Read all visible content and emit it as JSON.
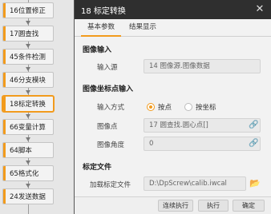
{
  "flow": {
    "nodes": [
      {
        "label": "16位置修正"
      },
      {
        "label": "17圆查找"
      },
      {
        "label": "45条件检测"
      },
      {
        "label": "46分支模块"
      },
      {
        "label": "18标定转换"
      },
      {
        "label": "66变量计算"
      },
      {
        "label": "64脚本"
      },
      {
        "label": "65格式化"
      },
      {
        "label": "24发送数据"
      }
    ]
  },
  "dialog": {
    "title": "18 标定转换",
    "tabs": [
      {
        "label": "基本参数"
      },
      {
        "label": "结果显示"
      }
    ],
    "image_input": {
      "section": "图像输入",
      "source_label": "输入源",
      "source_value": "14 图像源.图像数据"
    },
    "coord_input": {
      "section": "图像坐标点输入",
      "mode_label": "输入方式",
      "mode_options": [
        {
          "label": "按点"
        },
        {
          "label": "按坐标"
        }
      ],
      "point_label": "图像点",
      "point_value": "17 圆查找.圆心点[]",
      "angle_label": "图像角度",
      "angle_value": "0"
    },
    "calib": {
      "section": "标定文件",
      "file_label": "加载标定文件",
      "file_value": "D:\\DpScrew\\calib.iwcal"
    },
    "buttons": {
      "continuous": "连续执行",
      "run": "执行",
      "ok": "确定"
    }
  },
  "colors": {
    "accent": "#f29b1d",
    "titlebar": "#2f2f2f"
  }
}
